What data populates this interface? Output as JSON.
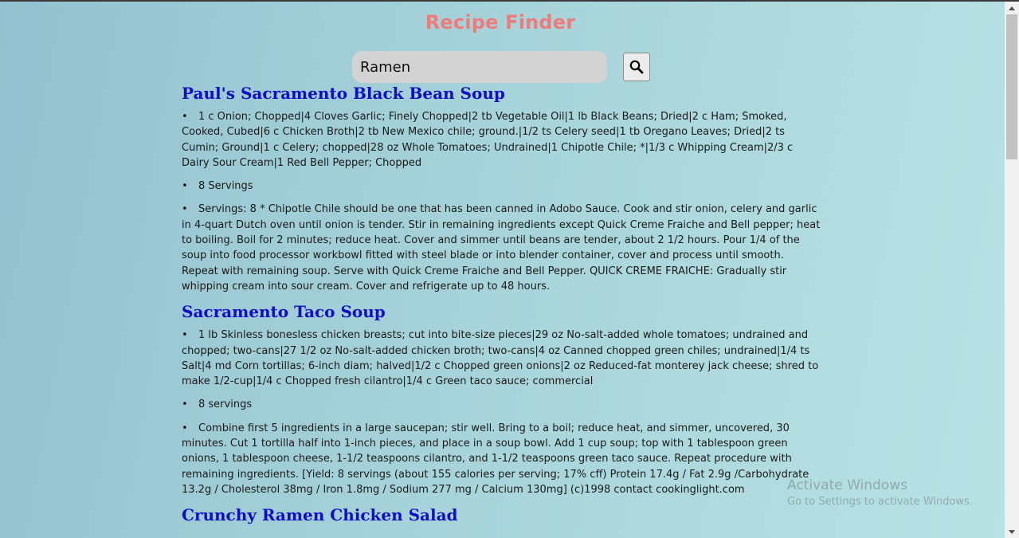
{
  "header": {
    "title": "Recipe Finder"
  },
  "search": {
    "value": "Ramen",
    "button_icon": "search-icon"
  },
  "recipes": [
    {
      "title": "Paul's Sacramento Black Bean Soup",
      "ingredients": "1 c Onion; Chopped|4 Cloves Garlic; Finely Chopped|2 tb Vegetable Oil|1 lb Black Beans; Dried|2 c Ham; Smoked, Cooked, Cubed|6 c Chicken Broth|2 tb New Mexico chile; ground.|1/2 ts Celery seed|1 tb Oregano Leaves; Dried|2 ts Cumin; Ground|1 c Celery; chopped|28 oz Whole Tomatoes; Undrained|1 Chipotle Chile; *|1/3 c Whipping Cream|2/3 c Dairy Sour Cream|1 Red Bell Pepper; Chopped",
      "servings": "8 Servings",
      "directions": "Servings: 8 * Chipotle Chile should be one that has been canned in Adobo Sauce. Cook and stir onion, celery and garlic in 4-quart Dutch oven until onion is tender. Stir in remaining ingredients except Quick Creme Fraiche and Bell pepper; heat to boiling. Boil for 2 minutes; reduce heat. Cover and simmer until beans are tender, about 2 1/2 hours. Pour 1/4 of the soup into food processor workbowl fitted with steel blade or into blender container, cover and process until smooth. Repeat with remaining soup. Serve with Quick Creme Fraiche and Bell Pepper. QUICK CREME FRAICHE: Gradually stir whipping cream into sour cream. Cover and refrigerate up to 48 hours."
    },
    {
      "title": "Sacramento Taco Soup",
      "ingredients": "1 lb Skinless bonesless chicken breasts; cut into bite-size pieces|29 oz No-salt-added whole tomatoes; undrained and chopped; two-cans|27 1/2 oz No-salt-added chicken broth; two-cans|4 oz Canned chopped green chiles; undrained|1/4 ts Salt|4 md Corn tortillas; 6-inch diam; halved|1/2 c Chopped green onions|2 oz Reduced-fat monterey jack cheese; shred to make 1/2-cup|1/4 c Chopped fresh cilantro|1/4 c Green taco sauce; commercial",
      "servings": "8 servings",
      "directions": "Combine first 5 ingredients in a large saucepan; stir well. Bring to a boil; reduce heat, and simmer, uncovered, 30 minutes. Cut 1 tortilla half into 1-inch pieces, and place in a soup bowl. Add 1 cup soup; top with 1 tablespoon green onions, 1 tablespoon cheese, 1-1/2 teaspoons cilantro, and 1-1/2 teaspoons green taco sauce. Repeat procedure with remaining ingredients. [Yield: 8 servings (about 155 calories per serving; 17% cff) Protein 17.4g / Fat 2.9g /Carbohydrate 13.2g / Cholesterol 38mg / Iron 1.8mg / Sodium 277 mg / Calcium 130mg] (c)1998 contact cookinglight.com"
    },
    {
      "title": "Crunchy Ramen Chicken Salad"
    }
  ],
  "watermark": {
    "title": "Activate Windows",
    "subtitle": "Go to Settings to activate Windows."
  },
  "colors": {
    "title": "#ef7b7b",
    "recipe_title": "#0d0dcc",
    "background_start": "#93c1cf",
    "background_end": "#b8e3e5"
  }
}
